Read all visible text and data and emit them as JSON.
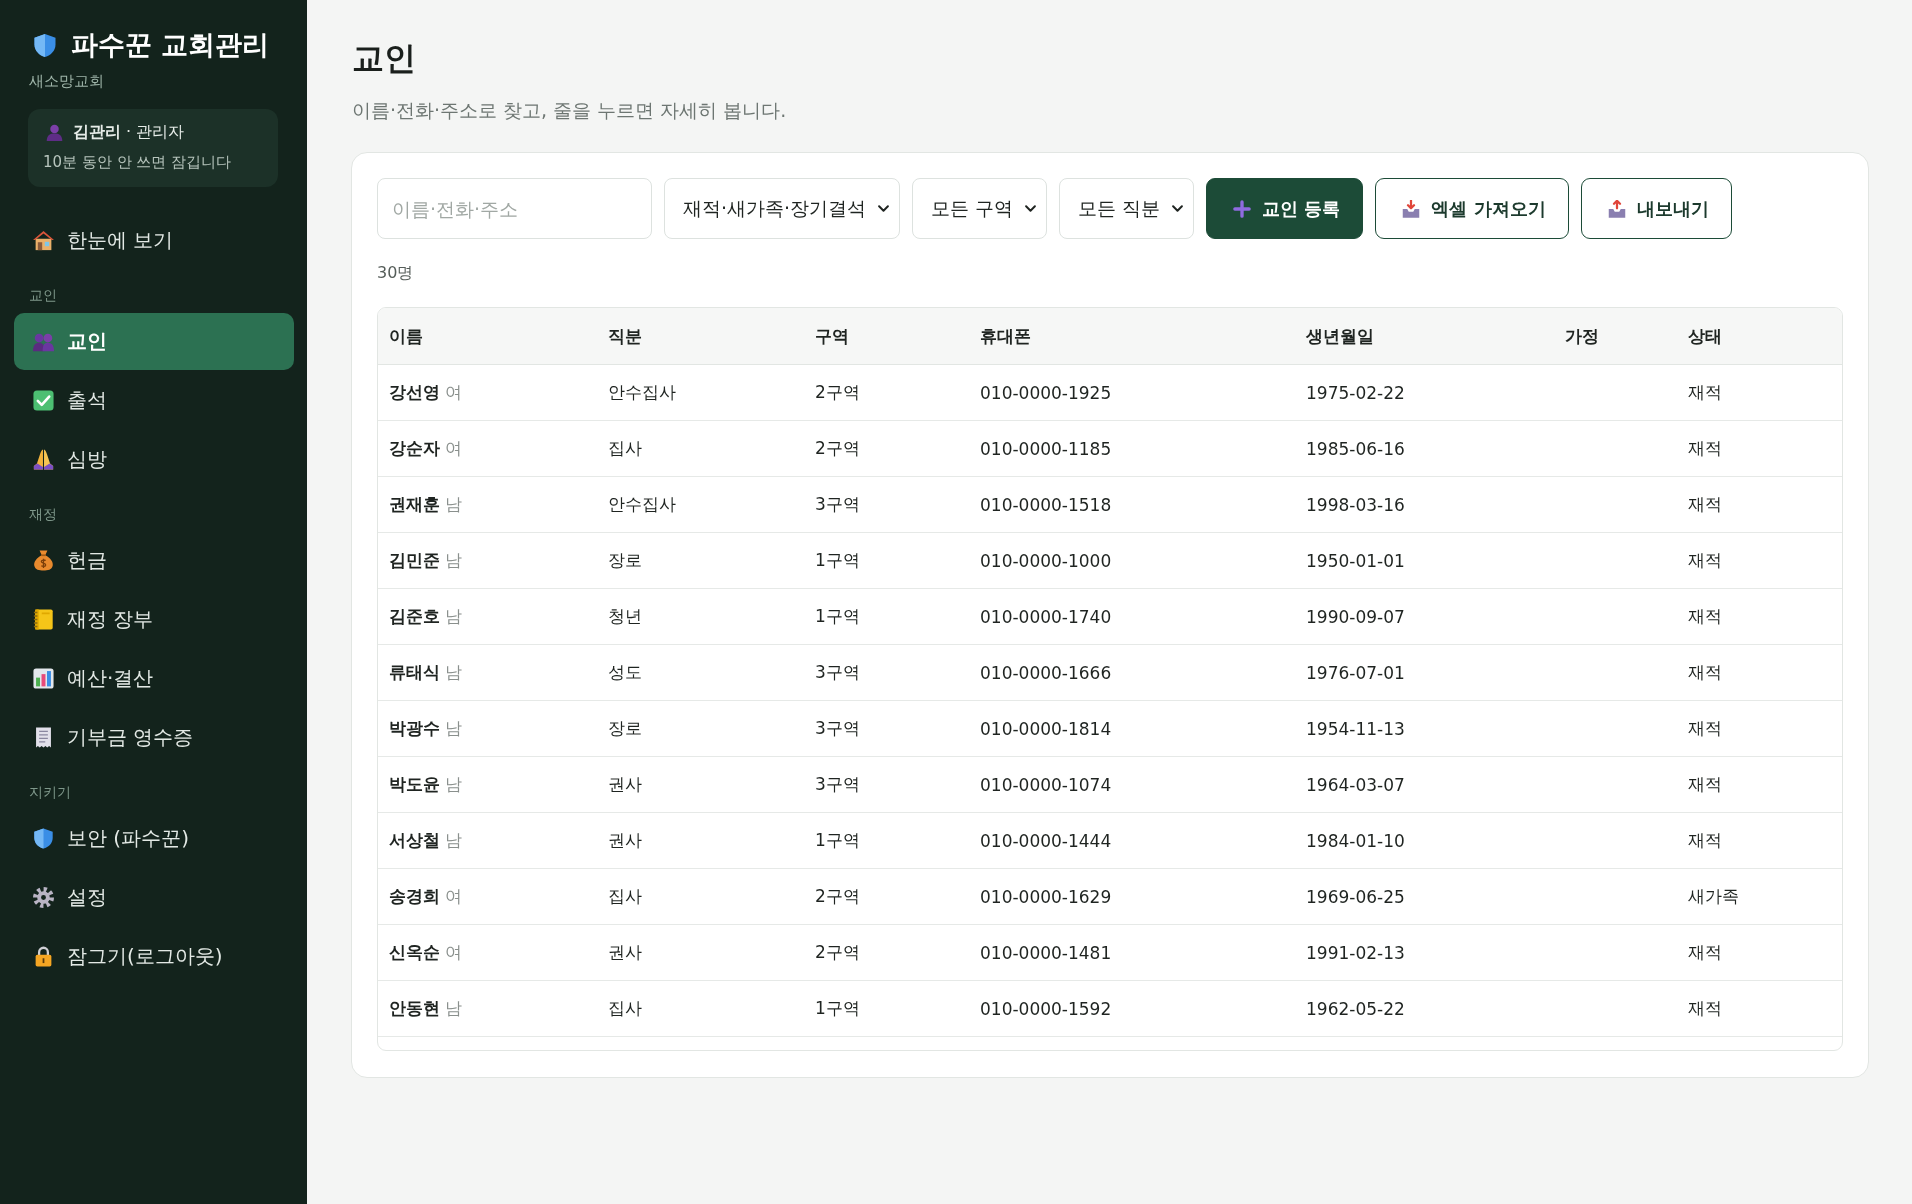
{
  "sidebar": {
    "title": "파수꾼 교회관리",
    "church": "새소망교회",
    "user": {
      "label": "**김관리** · 관리자",
      "note": "10분 동안 안 쓰면 잠깁니다"
    },
    "sections": [
      {
        "items": [
          {
            "label": "한눈에 보기",
            "selected": false
          }
        ]
      },
      {
        "heading": "교인",
        "items": [
          {
            "label": "교인",
            "selected": true
          },
          {
            "label": "출석",
            "selected": false
          },
          {
            "label": "심방",
            "selected": false
          }
        ]
      },
      {
        "heading": "재정",
        "items": [
          {
            "label": "헌금",
            "selected": false
          },
          {
            "label": "재정 장부",
            "selected": false
          },
          {
            "label": "예산·결산",
            "selected": false
          },
          {
            "label": "기부금 영수증",
            "selected": false
          }
        ]
      },
      {
        "heading": "지키기",
        "items": [
          {
            "label": "보안 (파수꾼)",
            "selected": false
          },
          {
            "label": "설정",
            "selected": false
          },
          {
            "label": "잠그기(로그아웃)",
            "selected": false
          }
        ]
      }
    ]
  },
  "page": {
    "title": "교인",
    "subtitle": "이름·전화·주소로 찾고, 줄을 누르면 자세히 봅니다."
  },
  "toolbar": {
    "search": {
      "placeholder": "이름·전화·주소"
    },
    "filters": [
      {
        "value": "재적·새가족·장기결석"
      },
      {
        "value": "모든 구역"
      },
      {
        "value": "모든 직분"
      }
    ],
    "buttons": [
      {
        "label": "교인 등록",
        "kind": "primary"
      },
      {
        "label": "엑셀 가져오기",
        "kind": "outline"
      },
      {
        "label": "내보내기",
        "kind": "outline"
      }
    ]
  },
  "count": "30명",
  "table": {
    "columns": [
      "이름",
      "직분",
      "구역",
      "휴대폰",
      "생년월일",
      "가정",
      "상태"
    ],
    "rows": [
      {
        "name": "강선영",
        "gender": "여",
        "role": "안수집사",
        "district": "2구역",
        "phone": "010-0000-1925",
        "birth": "1975-02-22",
        "status": "재적"
      },
      {
        "name": "강순자",
        "gender": "여",
        "role": "집사",
        "district": "2구역",
        "phone": "010-0000-1185",
        "birth": "1985-06-16",
        "status": "재적"
      },
      {
        "name": "권재훈",
        "gender": "남",
        "role": "안수집사",
        "district": "3구역",
        "phone": "010-0000-1518",
        "birth": "1998-03-16",
        "status": "재적"
      },
      {
        "name": "김민준",
        "gender": "남",
        "role": "장로",
        "district": "1구역",
        "phone": "010-0000-1000",
        "birth": "1950-01-01",
        "status": "재적"
      },
      {
        "name": "김준호",
        "gender": "남",
        "role": "청년",
        "district": "1구역",
        "phone": "010-0000-1740",
        "birth": "1990-09-07",
        "status": "재적"
      },
      {
        "name": "류태식",
        "gender": "남",
        "role": "성도",
        "district": "3구역",
        "phone": "010-0000-1666",
        "birth": "1976-07-01",
        "status": "재적"
      },
      {
        "name": "박광수",
        "gender": "남",
        "role": "장로",
        "district": "3구역",
        "phone": "010-0000-1814",
        "birth": "1954-11-13",
        "status": "재적"
      },
      {
        "name": "박도윤",
        "gender": "남",
        "role": "권사",
        "district": "3구역",
        "phone": "010-0000-1074",
        "birth": "1964-03-07",
        "status": "재적"
      },
      {
        "name": "서상철",
        "gender": "남",
        "role": "권사",
        "district": "1구역",
        "phone": "010-0000-1444",
        "birth": "1984-01-10",
        "status": "재적"
      },
      {
        "name": "송경희",
        "gender": "여",
        "role": "집사",
        "district": "2구역",
        "phone": "010-0000-1629",
        "birth": "1969-06-25",
        "status": "새가족"
      },
      {
        "name": "신옥순",
        "gender": "여",
        "role": "권사",
        "district": "2구역",
        "phone": "010-0000-1481",
        "birth": "1991-02-13",
        "status": "재적"
      },
      {
        "name": "안동현",
        "gender": "남",
        "role": "집사",
        "district": "1구역",
        "phone": "010-0000-1592",
        "birth": "1962-05-22",
        "status": "재적"
      }
    ]
  }
}
